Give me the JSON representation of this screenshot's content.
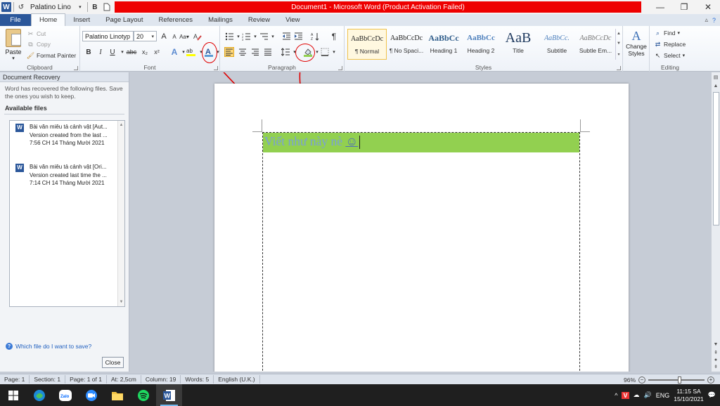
{
  "titlebar": {
    "app_letter": "W",
    "qat_font": "Palatino Lino",
    "qat_bold": "B",
    "title": "Document1 - Microsoft Word (Product Activation Failed)"
  },
  "tabs": {
    "file": "File",
    "items": [
      "Home",
      "Insert",
      "Page Layout",
      "References",
      "Mailings",
      "Review",
      "View"
    ],
    "active": "Home"
  },
  "clipboard": {
    "paste": "Paste",
    "cut": "Cut",
    "copy": "Copy",
    "format_painter": "Format Painter",
    "label": "Clipboard"
  },
  "font": {
    "name": "Palatino Linotyp",
    "size": "20",
    "label": "Font",
    "bold": "B",
    "italic": "I",
    "underline": "U",
    "strike": "abc",
    "subscript": "x₂",
    "superscript": "x²",
    "grow": "A",
    "shrink": "A",
    "color_letter": "A",
    "highlight_letter": "ab"
  },
  "paragraph": {
    "label": "Paragraph"
  },
  "styles": {
    "label": "Styles",
    "items": [
      {
        "sample": "AaBbCcDc",
        "name": "¶ Normal"
      },
      {
        "sample": "AaBbCcDc",
        "name": "¶ No Spaci..."
      },
      {
        "sample": "AaBbCc",
        "name": "Heading 1"
      },
      {
        "sample": "AaBbCc",
        "name": "Heading 2"
      },
      {
        "sample": "AaB",
        "name": "Title"
      },
      {
        "sample": "AaBbCc.",
        "name": "Subtitle"
      },
      {
        "sample": "AaBbCcDc",
        "name": "Subtle Em..."
      }
    ],
    "change_styles": "Change",
    "change_styles_2": "Styles"
  },
  "editing": {
    "label": "Editing",
    "find": "Find",
    "replace": "Replace",
    "select": "Select"
  },
  "recovery": {
    "title": "Document Recovery",
    "message": "Word has recovered the following files. Save the ones you wish to keep.",
    "available": "Available files",
    "files": [
      {
        "name": "Bài văn miêu tả cảnh vật  [Aut...",
        "desc": "Version created from the last ...",
        "time": "7:56 CH 14 Tháng Mười 2021"
      },
      {
        "name": "Bài văn miêu tả cảnh vật  [Ori...",
        "desc": "Version created last time the ...",
        "time": "7:14 CH 14 Tháng Mười 2021"
      }
    ],
    "help": "Which file do I want to save?",
    "close": "Close"
  },
  "document": {
    "text": "Viết như này nè ",
    "smiley": "☺",
    "highlight_color": "#92d050",
    "text_color": "#7a9fd8"
  },
  "status": {
    "page": "Page: 1",
    "section": "Section: 1",
    "pages": "Page: 1 of 1",
    "at": "At: 2,5cm",
    "column": "Column: 19",
    "words": "Words: 5",
    "language": "English (U.K.)",
    "zoom": "96%",
    "zoom_fraction": 0.56
  },
  "taskbar": {
    "tray_lang": "ENG",
    "time": "11:15 SA",
    "date": "15/10/2021"
  },
  "colors": {
    "title_bar_red": "#ee0000",
    "word_blue": "#2b579a",
    "annotation_red": "#e00000"
  }
}
